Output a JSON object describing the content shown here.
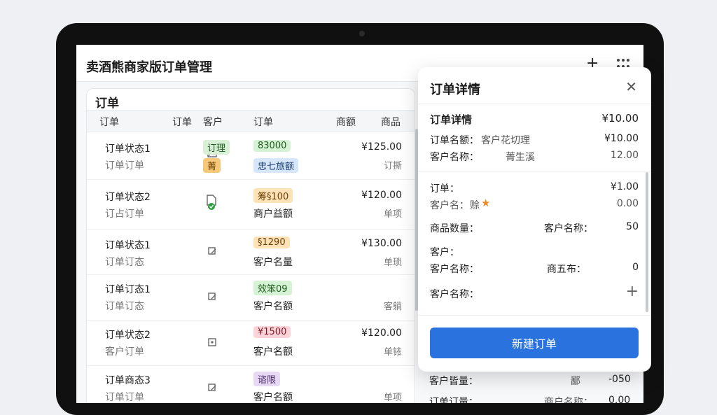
{
  "app": {
    "title": "卖酒熊商家版订单管理",
    "plus_icon": "plus-icon",
    "menu_icon": "apps-grid-icon"
  },
  "list": {
    "title": "订单",
    "columns": [
      "订单",
      "订单",
      "客户",
      "订单",
      "商额",
      "商品"
    ],
    "rows": [
      {
        "name": "订单状态1",
        "sub": "订单订单",
        "icon": "image-icon",
        "tag1": "订理",
        "tag1_color": "#d8f0d6",
        "tag2": "菁",
        "tag2_color": "#f7c87a",
        "tag3": "83000",
        "tag3_color": "#d6f2d4",
        "tag4": "忠七旅额",
        "tag4_color": "#d6e7fb",
        "amount": "¥125.00",
        "amount_sub": "订撕"
      },
      {
        "name": "订单状态2",
        "sub": "订占订单",
        "icon": "doc-check-icon",
        "tag3": "筹§100",
        "tag3_color": "#fde2b8",
        "line2": "商户益额",
        "amount": "¥120.00",
        "amount_sub": "单项"
      },
      {
        "name": "订单状态1",
        "sub": "订单订态",
        "icon": "edit-icon",
        "tag3": "§1290",
        "tag3_color": "#fde2b8",
        "line2": "客户名量",
        "amount": "¥130.00",
        "amount_sub": "单琐"
      },
      {
        "name": "订单订态1",
        "sub": "订单订态",
        "icon": "edit-icon",
        "tag3": "效笨09",
        "tag3_color": "#d6f2d4",
        "line2": "客户名额",
        "amount": "",
        "amount_sub": "客躺"
      },
      {
        "name": "订单状态2",
        "sub": "客户订单",
        "icon": "square-icon",
        "tag3": "¥1500",
        "tag3_color": "#fbd3d8",
        "line2": "客户名额",
        "amount": "¥120.00",
        "amount_sub": "单铱"
      },
      {
        "name": "订单商态3",
        "sub": "订单订单",
        "icon": "edit-icon",
        "tag3": "谘限",
        "tag3_color": "#e7d9f3",
        "line2": "客户名额",
        "amount": "",
        "amount_sub": "单项"
      }
    ]
  },
  "panel": {
    "title": "订单详情",
    "close_icon": "close-icon",
    "section1": {
      "heading": "订单详情",
      "heading_value": "¥10.00",
      "r1_label": "订单名额：",
      "r1_mid": "客户花切理",
      "r1_value": "¥10.00",
      "r2_label": "客户名称：",
      "r2_mid": "菁生溪",
      "r2_value": "12.00"
    },
    "section2": {
      "r1_label": "订单：",
      "r1_value": "¥1.00",
      "r2_label": "客户名：",
      "r2_mid": "赊",
      "r2_value": "0.00",
      "star_icon": "star-icon",
      "r3_label": "商品数量：",
      "r3_mid": "客户名称：",
      "r3_value": "50",
      "r4_label": "客户：",
      "r5_label": "客户名称：",
      "r5_mid": "商五布：",
      "r5_value": "0",
      "r6_label": "客户名称：",
      "plus_icon": "plus-icon"
    },
    "button": "新建订单"
  },
  "below": {
    "r1_label": "客户皆量：",
    "r1_mid": "鄙",
    "r1_value": "-050",
    "r2_label": "订单订量：",
    "r2_mid": "商户名称：",
    "r2_value": "0.00"
  }
}
